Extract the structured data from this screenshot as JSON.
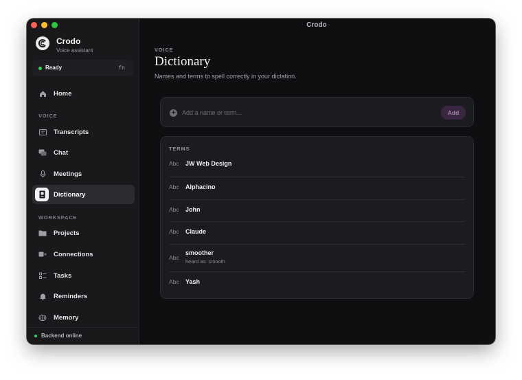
{
  "window": {
    "title": "Crodo"
  },
  "brand": {
    "name": "Crodo",
    "subtitle": "Voice assistant"
  },
  "status": {
    "label": "Ready",
    "shortcut": "fn"
  },
  "sidebar": {
    "home": {
      "label": "Home",
      "icon": "home-icon"
    },
    "voice_section": "VOICE",
    "voice_items": [
      {
        "label": "Transcripts",
        "icon": "transcript-icon"
      },
      {
        "label": "Chat",
        "icon": "chat-icon"
      },
      {
        "label": "Meetings",
        "icon": "microphone-icon"
      },
      {
        "label": "Dictionary",
        "icon": "dictionary-icon",
        "active": true
      }
    ],
    "workspace_section": "WORKSPACE",
    "workspace_items": [
      {
        "label": "Projects",
        "icon": "folder-icon"
      },
      {
        "label": "Connections",
        "icon": "connection-icon"
      },
      {
        "label": "Tasks",
        "icon": "tasks-icon"
      },
      {
        "label": "Reminders",
        "icon": "bell-icon"
      },
      {
        "label": "Memory",
        "icon": "brain-icon"
      }
    ],
    "footer": {
      "label": "Backend online"
    }
  },
  "main": {
    "eyebrow": "VOICE",
    "title": "Dictionary",
    "subtitle": "Names and terms to spell correctly in your dictation.",
    "add": {
      "placeholder": "Add a name or term...",
      "button_label": "Add"
    },
    "terms_header": "TERMS",
    "terms": [
      {
        "type": "Abc",
        "text": "JW Web Design"
      },
      {
        "type": "Abc",
        "text": "Alphacino"
      },
      {
        "type": "Abc",
        "text": "John"
      },
      {
        "type": "Abc",
        "text": "Claude"
      },
      {
        "type": "Abc",
        "text": "smoother",
        "hint": "heard as: smooth"
      },
      {
        "type": "Abc",
        "text": "Yash"
      }
    ]
  },
  "colors": {
    "accent": "#a186b0",
    "status_green": "#34d058",
    "background": "#0f0f11"
  }
}
